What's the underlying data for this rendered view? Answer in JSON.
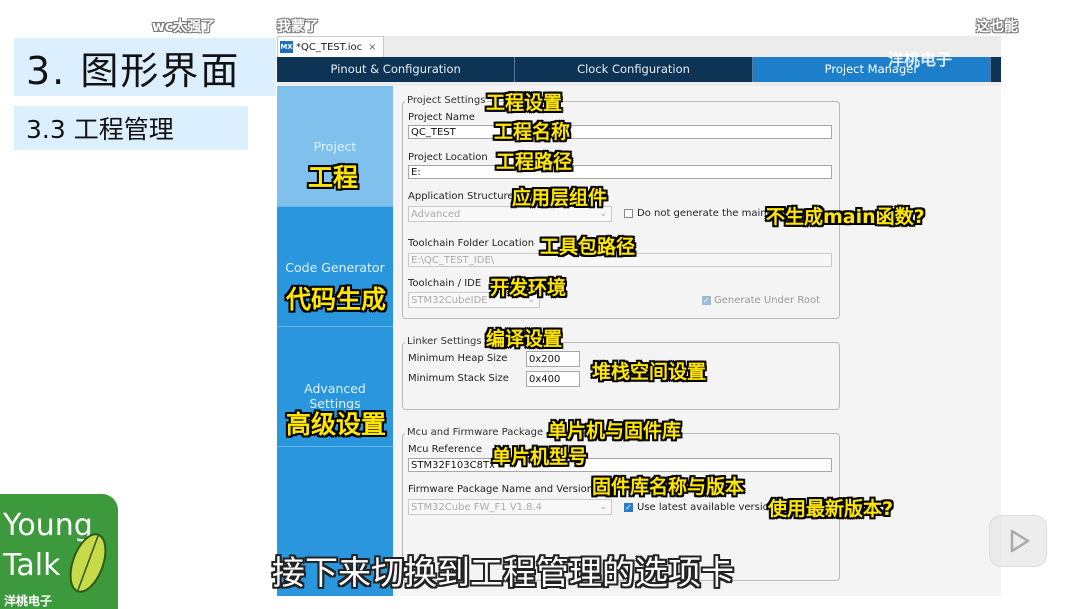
{
  "slide": {
    "title": "3. 图形界面",
    "subtitle": "3.3 工程管理"
  },
  "danmaku": [
    "wc太强了",
    "我蒙了",
    "这也能"
  ],
  "watermark": "洋桃电子",
  "window": {
    "file_tab": "*QC_TEST.ioc",
    "mx_badge": "MX",
    "close_icon": "×",
    "tabs": [
      "Pinout & Configuration",
      "Clock Configuration",
      "Project Manager"
    ],
    "active_tab": "Project Manager"
  },
  "sidebar": {
    "items": [
      {
        "label": "Project",
        "annotation": "工程"
      },
      {
        "label": "Code Generator",
        "annotation": "代码生成"
      },
      {
        "label": "Advanced Settings",
        "annotation": "高级设置"
      }
    ]
  },
  "project_settings": {
    "group_title": "Project Settings",
    "group_annotation": "工程设置",
    "name_label": "Project Name",
    "name_value": "QC_TEST",
    "name_annotation": "工程名称",
    "location_label": "Project Location",
    "location_value": "E:",
    "location_annotation": "工程路径",
    "app_structure_label": "Application Structure",
    "app_structure_value": "Advanced",
    "app_structure_annotation": "应用层组件",
    "no_main_label": "Do not generate the main()",
    "no_main_annotation": "不生成main函数?",
    "toolchain_folder_label": "Toolchain Folder Location",
    "toolchain_folder_value": "E:\\QC_TEST_IDE\\",
    "toolchain_folder_annotation": "工具包路径",
    "toolchain_ide_label": "Toolchain / IDE",
    "toolchain_ide_value": "STM32CubeIDE",
    "toolchain_ide_annotation": "开发环境",
    "generate_under_root_label": "Generate Under Root"
  },
  "linker_settings": {
    "group_title": "Linker Settings",
    "group_annotation": "编译设置",
    "heap_label": "Minimum Heap Size",
    "heap_value": "0x200",
    "stack_label": "Minimum Stack Size",
    "stack_value": "0x400",
    "annotation": "堆栈空间设置"
  },
  "mcu_firmware": {
    "group_title": "Mcu and Firmware Package",
    "group_annotation": "单片机与固件库",
    "mcu_label": "Mcu Reference",
    "mcu_value": "STM32F103C8Tx",
    "mcu_annotation": "单片机型号",
    "fw_label": "Firmware Package Name and Version",
    "fw_value": "STM32Cube FW_F1 V1.8.4",
    "fw_annotation": "固件库名称与版本",
    "use_latest_label": "Use latest available version",
    "use_latest_annotation": "使用最新版本?"
  },
  "caption": "接下来切换到工程管理的选项卡",
  "logo": {
    "line1": "Young",
    "line2": "Talk",
    "line3": "洋桃电子"
  }
}
